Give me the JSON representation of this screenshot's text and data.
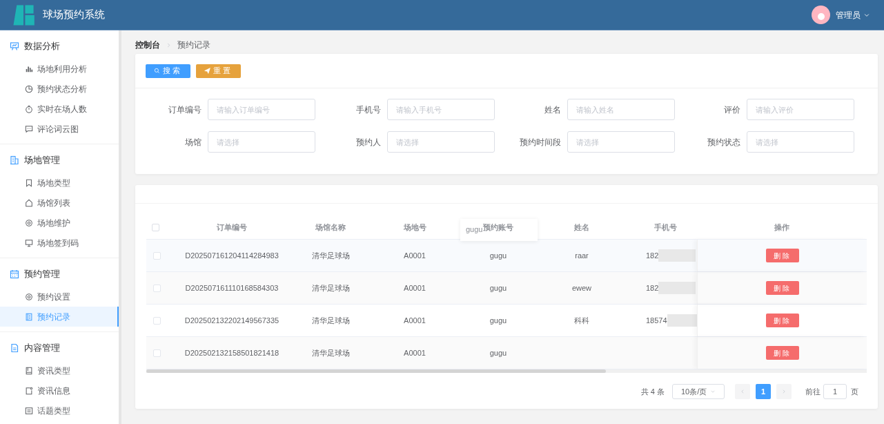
{
  "header": {
    "title": "球场预约系统",
    "user": "管理员"
  },
  "sidebar": {
    "sections": [
      {
        "title": "数据分析",
        "items": [
          {
            "label": "场地利用分析",
            "selected": false
          },
          {
            "label": "预约状态分析",
            "selected": false
          },
          {
            "label": "实时在场人数",
            "selected": false
          },
          {
            "label": "评论词云图",
            "selected": false
          }
        ]
      },
      {
        "title": "场地管理",
        "items": [
          {
            "label": "场地类型",
            "selected": false
          },
          {
            "label": "场馆列表",
            "selected": false
          },
          {
            "label": "场地维护",
            "selected": false
          },
          {
            "label": "场地签到码",
            "selected": false
          }
        ]
      },
      {
        "title": "预约管理",
        "items": [
          {
            "label": "预约设置",
            "selected": false
          },
          {
            "label": "预约记录",
            "selected": true
          }
        ]
      },
      {
        "title": "内容管理",
        "items": [
          {
            "label": "资讯类型",
            "selected": false
          },
          {
            "label": "资讯信息",
            "selected": false
          },
          {
            "label": "话题类型",
            "selected": false
          }
        ]
      }
    ]
  },
  "breadcrumb": [
    "控制台",
    "预约记录"
  ],
  "search_buttons": [
    "搜索",
    "重置"
  ],
  "filters": [
    {
      "label": "订单编号",
      "placeholder": "请输入订单编号"
    },
    {
      "label": "手机号",
      "placeholder": "请输入手机号"
    },
    {
      "label": "姓名",
      "placeholder": "请输入姓名"
    },
    {
      "label": "评价",
      "placeholder": "请输入评价"
    },
    {
      "label": "场馆",
      "placeholder": "请选择"
    },
    {
      "label": "预约人",
      "placeholder": "请选择"
    },
    {
      "label": "预约时间段",
      "placeholder": "请选择"
    },
    {
      "label": "预约状态",
      "placeholder": "请选择"
    }
  ],
  "table": {
    "columns": [
      "订单编号",
      "场馆名称",
      "场地号",
      "预约账号",
      "姓名",
      "手机号",
      "操作"
    ],
    "tooltip": "gugu",
    "all_checked": false,
    "rows": [
      {
        "checked": false,
        "cells": [
          "D202507161204114284983",
          "清华足球场",
          "A0001",
          "gugu",
          "raar",
          "182"
        ],
        "action": "删除"
      },
      {
        "checked": false,
        "cells": [
          "D202507161110168584303",
          "清华足球场",
          "A0001",
          "gugu",
          "ewew",
          "182"
        ],
        "action": "删除"
      },
      {
        "checked": false,
        "cells": [
          "D202502132202149567335",
          "清华足球场",
          "A0001",
          "gugu",
          "科科",
          "18574"
        ],
        "action": "删除"
      },
      {
        "checked": false,
        "cells": [
          "D202502132158501821418",
          "清华足球场",
          "A0001",
          "gugu",
          "",
          ""
        ],
        "action": "删除"
      }
    ]
  },
  "pagination": {
    "total": "共 4 条",
    "page_size": "10条/页",
    "pages": [
      {
        "label": "1",
        "selected": true
      }
    ],
    "goto_label": "前往",
    "goto_value": "1",
    "goto_suffix": "页"
  }
}
